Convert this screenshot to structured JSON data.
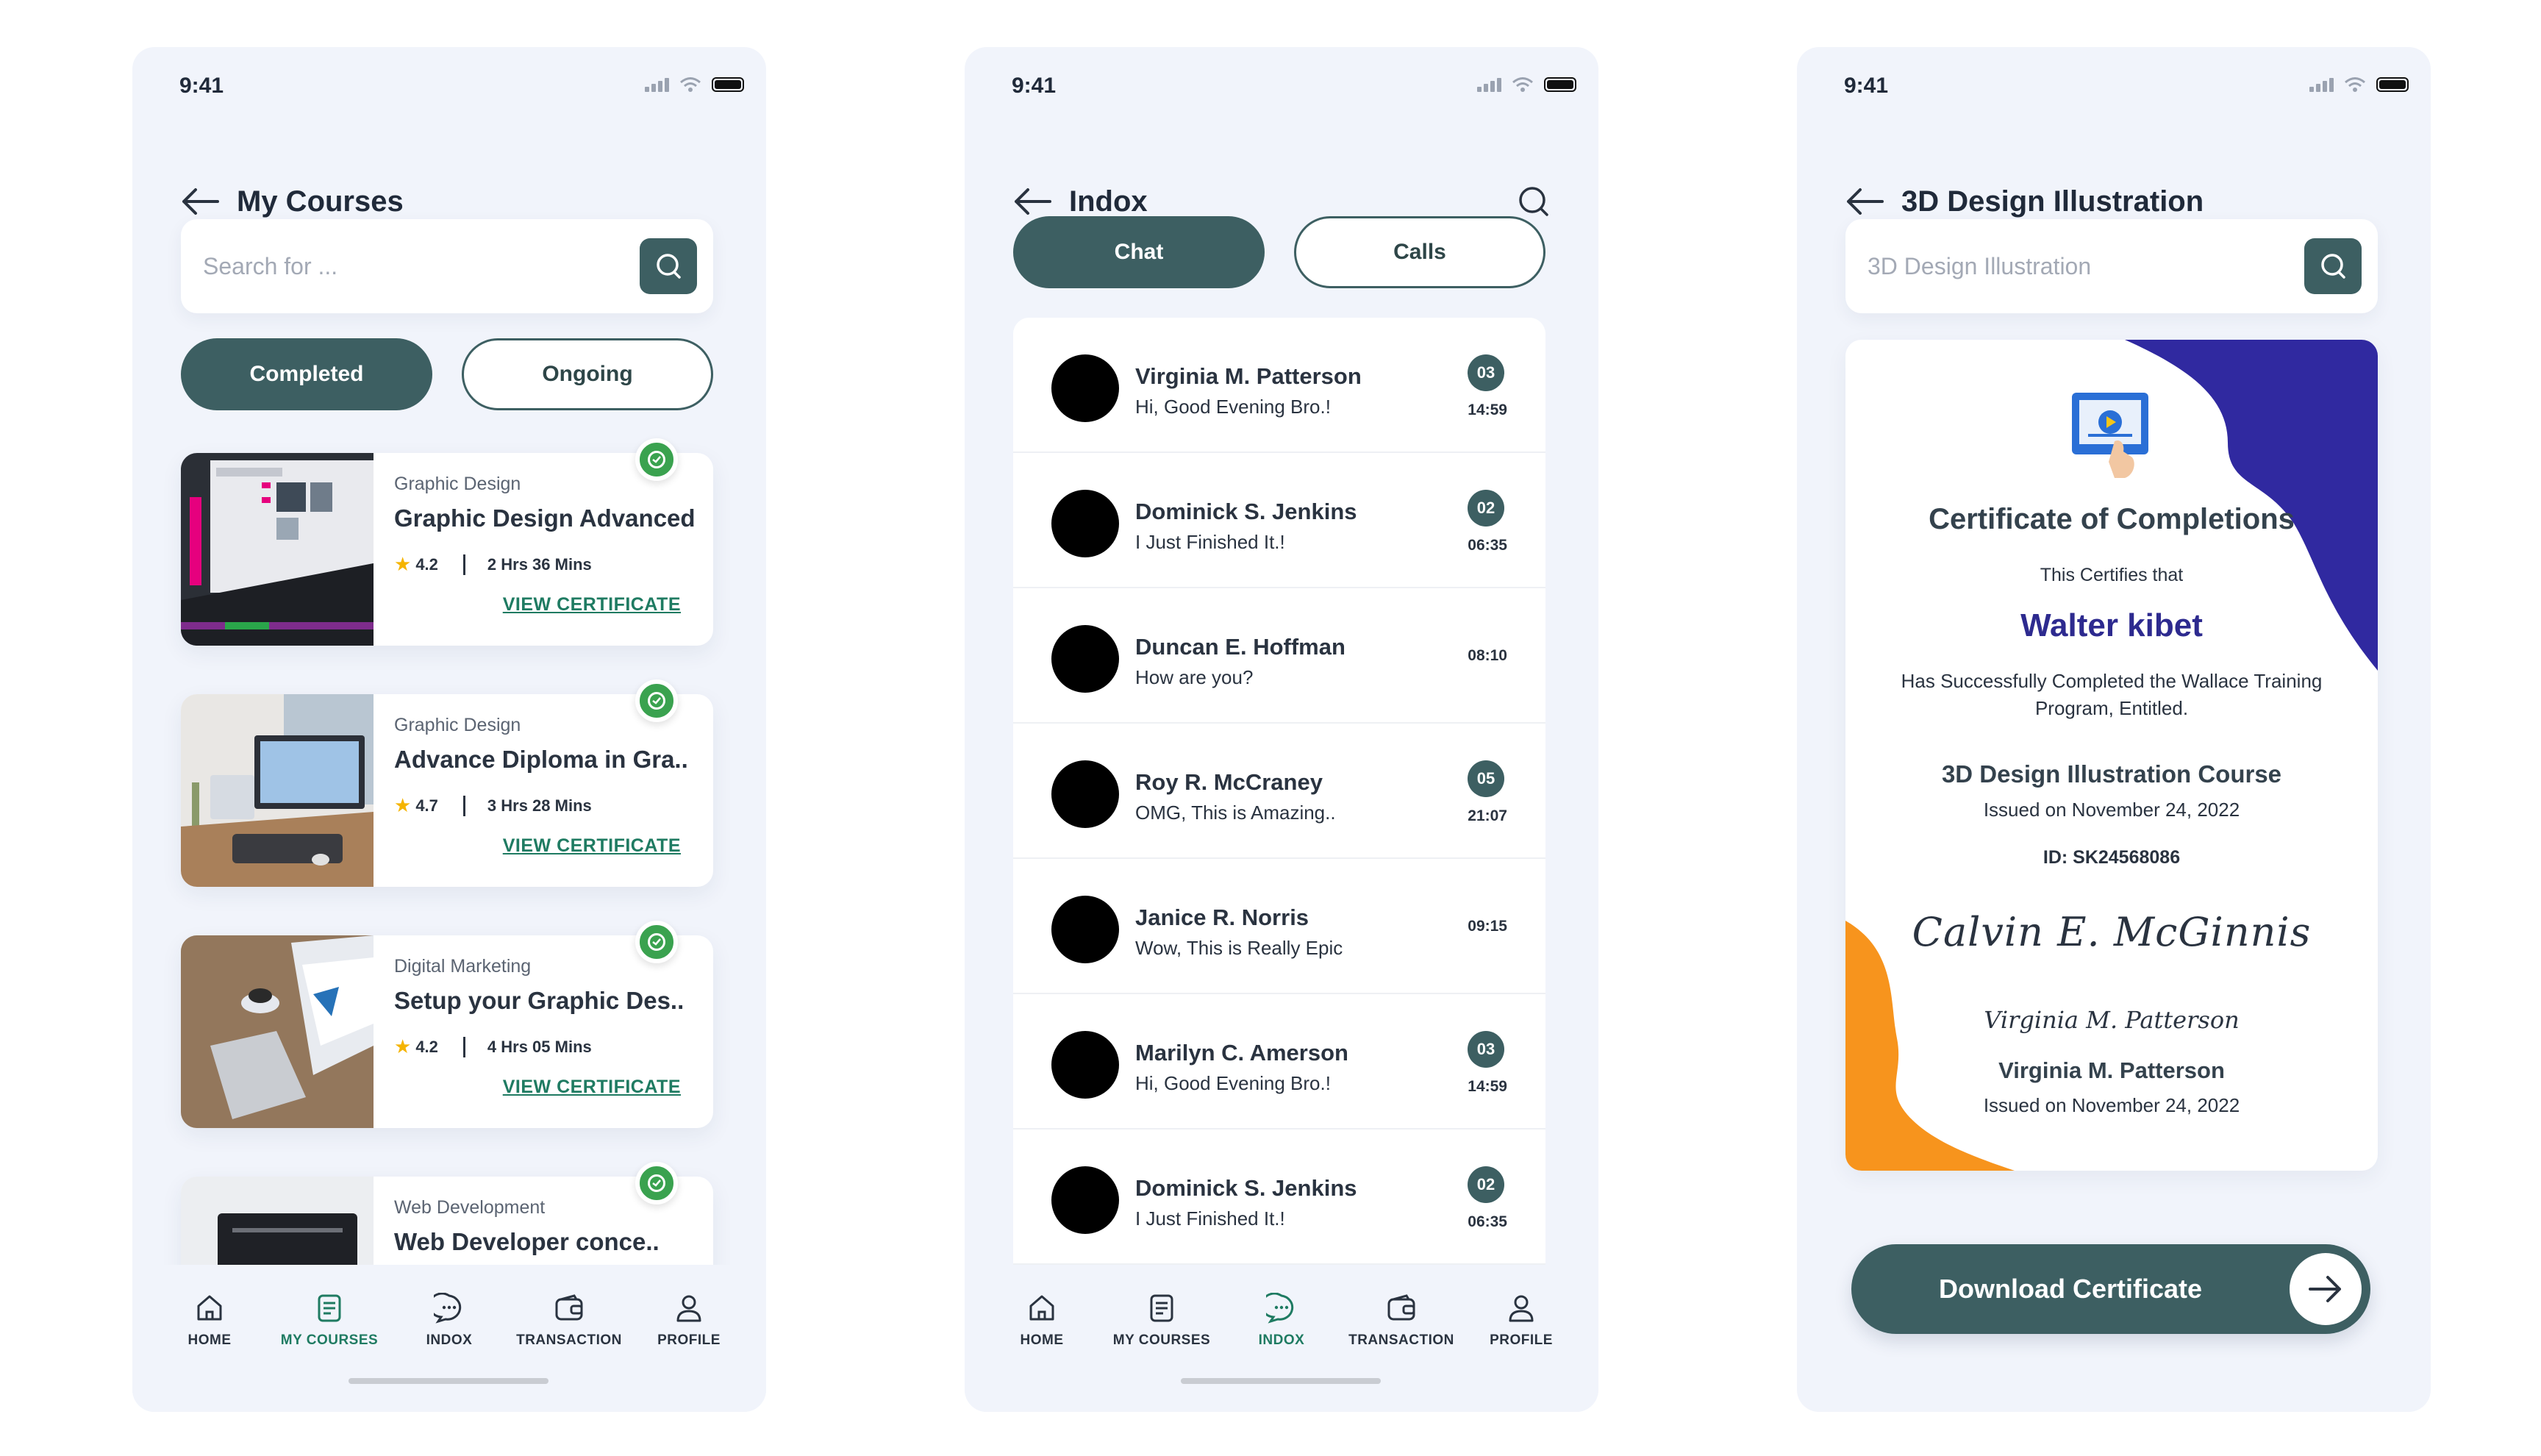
{
  "status": {
    "time": "9:41"
  },
  "screen1": {
    "title": "My Courses",
    "search_placeholder": "Search for ...",
    "tabs": {
      "active": "Completed",
      "inactive": "Ongoing"
    },
    "courses": [
      {
        "category": "Graphic Design",
        "name": "Graphic Design Advanced",
        "rating": "4.2",
        "duration": "2 Hrs 36 Mins",
        "link": "VIEW CERTIFICATE"
      },
      {
        "category": "Graphic Design",
        "name": "Advance Diploma in Gra..",
        "rating": "4.7",
        "duration": "3 Hrs 28 Mins",
        "link": "VIEW CERTIFICATE"
      },
      {
        "category": "Digital Marketing",
        "name": "Setup your Graphic Des..",
        "rating": "4.2",
        "duration": "4 Hrs 05 Mins",
        "link": "VIEW CERTIFICATE"
      },
      {
        "category": "Web Development",
        "name": "Web Developer conce..",
        "rating": "",
        "duration": "",
        "link": ""
      }
    ]
  },
  "screen2": {
    "title": "Indox",
    "tabs": {
      "active": "Chat",
      "inactive": "Calls"
    },
    "chats": [
      {
        "name": "Virginia M. Patterson",
        "message": "Hi, Good Evening Bro.!",
        "badge": "03",
        "time": "14:59"
      },
      {
        "name": "Dominick S. Jenkins",
        "message": "I Just Finished It.!",
        "badge": "02",
        "time": "06:35"
      },
      {
        "name": "Duncan E. Hoffman",
        "message": "How are you?",
        "badge": "",
        "time": "08:10"
      },
      {
        "name": "Roy R. McCraney",
        "message": "OMG, This is Amazing..",
        "badge": "05",
        "time": "21:07"
      },
      {
        "name": "Janice R. Norris",
        "message": "Wow, This is Really Epic",
        "badge": "",
        "time": "09:15"
      },
      {
        "name": "Marilyn C. Amerson",
        "message": "Hi, Good Evening Bro.!",
        "badge": "03",
        "time": "14:59"
      },
      {
        "name": "Dominick S. Jenkins",
        "message": "I Just Finished It.!",
        "badge": "02",
        "time": "06:35"
      }
    ]
  },
  "screen3": {
    "title": "3D Design Illustration",
    "search_value": "3D Design Illustration",
    "certificate": {
      "heading": "Certificate of Completions",
      "certifies": "This Certifies that",
      "recipient": "Walter kibet",
      "description": "Has Successfully Completed the Wallace Training Program, Entitled.",
      "course": "3D Design Illustration Course",
      "issued": "Issued on November 24, 2022",
      "id": "ID: SK24568086",
      "signature1": "Calvin E. McGinnis",
      "signature2": "Virginia M. Patterson",
      "signer_name": "Virginia M. Patterson",
      "signer_issued": "Issued on November 24, 2022"
    },
    "download_label": "Download Certificate"
  },
  "nav": {
    "home": "HOME",
    "courses": "MY COURSES",
    "indox": "INDOX",
    "transaction": "TRANSACTION",
    "profile": "PROFILE"
  },
  "colors": {
    "primary": "#3d5f62",
    "accent_green": "#1f7b62",
    "check_green": "#3aa24f",
    "cert_blue": "#3029a0",
    "cert_orange": "#f7941d",
    "background": "#f1f4fb"
  }
}
